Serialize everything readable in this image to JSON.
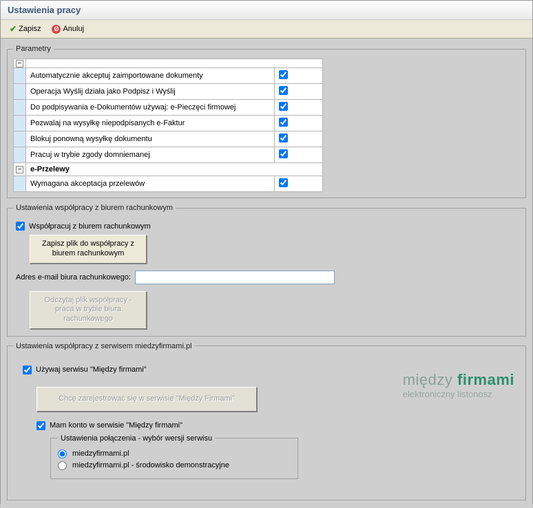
{
  "title": "Ustawienia pracy",
  "toolbar": {
    "save_label": "Zapisz",
    "cancel_label": "Anuluj"
  },
  "parameters": {
    "legend": "Parametry",
    "rows": [
      {
        "label": "Automatycznie akceptuj zaimportowane dokumenty",
        "checked": true
      },
      {
        "label": "Operacja Wyślij działa jako Podpisz i Wyślij",
        "checked": true
      },
      {
        "label": "Do podpisywania e-Dokumentów używaj: e-Pieczęci firmowej",
        "checked": true
      },
      {
        "label": "Pozwalaj na wysyłkę niepodpisanych e-Faktur",
        "checked": true
      },
      {
        "label": "Blokuj ponowną wysyłkę dokumentu",
        "checked": true
      },
      {
        "label": "Pracuj w trybie zgody domniemanej",
        "checked": true
      }
    ],
    "section2_label": "e-Przelewy",
    "section2_rows": [
      {
        "label": "Wymagana akceptacja przelewów",
        "checked": true
      }
    ]
  },
  "accounting": {
    "legend": "Ustawienia współpracy z biurem rachunkowym",
    "cooperate_label": "Współpracuj z biurem rachunkowym",
    "cooperate_checked": true,
    "save_file_btn": "Zapisz plik do współpracy z\nbiurem rachunkowym",
    "email_label": "Adres e-mail biura rachunkowego:",
    "email_value": "",
    "read_file_btn": "Odczytaj plik współpracy -\npraca w trybie biura\nrachunkowego"
  },
  "miedzyfirmami": {
    "legend": "Ustawienia współpracy z serwisem miedzyfirmami.pl",
    "use_service_label": "Używaj serwisu \"Między firmami\"",
    "use_service_checked": true,
    "register_btn": "Chcę zarejestrować się w serwisie \"Między Firmami\"",
    "have_account_label": "Mam konto w serwisie \"Między firmami\"",
    "have_account_checked": true,
    "connection_legend": "Ustawienia połączenia - wybór wersji serwisu",
    "radio1_label": "miedzyfirmami.pl",
    "radio2_label": "miedzyfirmami.pl - środowisko demonstracyjne",
    "radio_selected": 0,
    "logo_part1": "między ",
    "logo_part2": "firmami",
    "logo_sub": "elektroniczny listonosz"
  }
}
